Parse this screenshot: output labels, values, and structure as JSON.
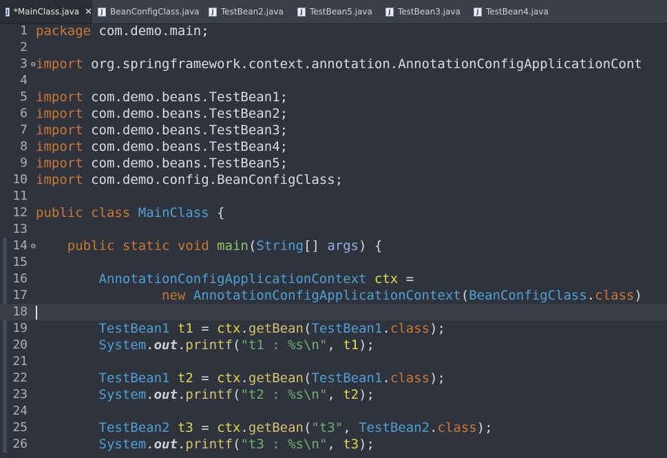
{
  "tabs": [
    {
      "label": "*MainClass.java",
      "active": true,
      "closable": true
    },
    {
      "label": "BeanConfigClass.java"
    },
    {
      "label": "TestBean2.java"
    },
    {
      "label": "TestBean5.java"
    },
    {
      "label": "TestBean3.java"
    },
    {
      "label": "TestBean4.java"
    }
  ],
  "editor": {
    "current_line": 18,
    "folded_markers": [
      3,
      14
    ],
    "lines": [
      {
        "n": "1",
        "text": "package com.demo.main;"
      },
      {
        "n": "2",
        "text": ""
      },
      {
        "n": "3",
        "text": "import org.springframework.context.annotation.AnnotationConfigApplicationCont"
      },
      {
        "n": "4",
        "text": ""
      },
      {
        "n": "5",
        "text": "import com.demo.beans.TestBean1;"
      },
      {
        "n": "6",
        "text": "import com.demo.beans.TestBean2;"
      },
      {
        "n": "7",
        "text": "import com.demo.beans.TestBean3;"
      },
      {
        "n": "8",
        "text": "import com.demo.beans.TestBean4;"
      },
      {
        "n": "9",
        "text": "import com.demo.beans.TestBean5;"
      },
      {
        "n": "10",
        "text": "import com.demo.config.BeanConfigClass;"
      },
      {
        "n": "11",
        "text": ""
      },
      {
        "n": "12",
        "text": "public class MainClass {"
      },
      {
        "n": "13",
        "text": ""
      },
      {
        "n": "14",
        "text": "    public static void main(String[] args) {"
      },
      {
        "n": "15",
        "text": ""
      },
      {
        "n": "16",
        "text": "        AnnotationConfigApplicationContext ctx ="
      },
      {
        "n": "17",
        "text": "                new AnnotationConfigApplicationContext(BeanConfigClass.class)"
      },
      {
        "n": "18",
        "text": ""
      },
      {
        "n": "19",
        "text": "        TestBean1 t1 = ctx.getBean(TestBean1.class);"
      },
      {
        "n": "20",
        "text": "        System.out.printf(\"t1 : %s\\n\", t1);"
      },
      {
        "n": "21",
        "text": ""
      },
      {
        "n": "22",
        "text": "        TestBean1 t2 = ctx.getBean(TestBean1.class);"
      },
      {
        "n": "23",
        "text": "        System.out.printf(\"t2 : %s\\n\", t2);"
      },
      {
        "n": "24",
        "text": ""
      },
      {
        "n": "25",
        "text": "        TestBean2 t3 = ctx.getBean(\"t3\", TestBean2.class);"
      },
      {
        "n": "26",
        "text": "        System.out.printf(\"t3 : %s\\n\", t3);"
      }
    ]
  },
  "colors": {
    "background": "#2f333d",
    "keyword": "#cc7832",
    "type": "#4ea1d3",
    "method": "#d7c36b",
    "variable": "#e6d94a",
    "string": "#6bb56b"
  }
}
